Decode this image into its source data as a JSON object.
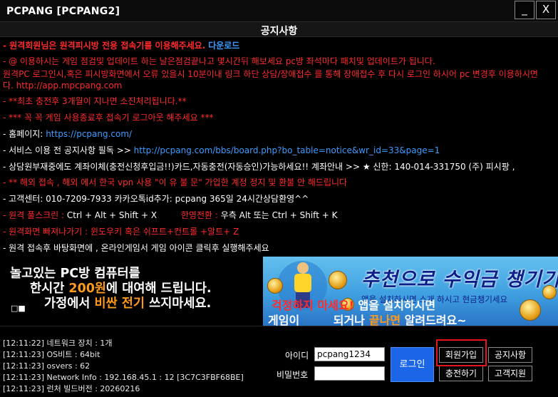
{
  "window": {
    "title": "PCPANG [PCPANG2]",
    "minimize_label": "_",
    "close_label": "X"
  },
  "notice": {
    "title": "공지사항",
    "lines": [
      {
        "a": "- 원격회원님은 원격피시방 전용 접속기를 이용해주세요.",
        "b": "다운로드"
      },
      {
        "a": "- @ 이용하시는 게임 점검및 업데이트 하는 날은점검끝나고 몇시간뒤 해보세요 pc방 좌석마다 패치및 업데이트가 됩니다."
      },
      {
        "a": "  원격PC 로그인시,혹은 피시방화면에서 오류 있을시 10분이내 링크 하단 상담/장애접수 를 통해 장애접수 후 다시 로그인 하시어 pc 변경후 이용하시면"
      },
      {
        "a": "  다. http://app.mpcpang.com"
      },
      {
        "a": "- **최초 충전후 3개월이 지나면 소진처리됩니다.**"
      },
      {
        "a": "- *** 꼭 꼭 게임 사용종료후 접속기 로그아웃 해주세요 ***"
      },
      {
        "a": "- 홈페이지:",
        "b": "https://pcpang.com/"
      },
      {
        "a": "- 서비스 이용 전 공지사항 필독 >>",
        "b": "http://pcpang.com/bbs/board.php?bo_table=notice&wr_id=33&page=1"
      },
      {
        "a": "- 상담원부재중에도 계좌이체(충전신청후입금!!)카드,자동충전(자동승인)가능하세요!! 계좌안내 >> ★ 신한: 140-014-331750 (주) 피시팡 ,"
      },
      {
        "a": "- ** 해외 접속 , 해외 에서 한국 vpn 사용 \"이 유 불 문\" 가입한 계정 정지 및 환불 안 해드립니다"
      },
      {
        "a": "- 고객센터: 010-7209-7933 카카오톡id추가: pcpang 365일 24시간상담환영^^"
      },
      {
        "a": "- 원격 풀스크린 :",
        "b": "Ctrl + Alt + Shift + X",
        "c": "한영전환 :",
        "d": "우측 Alt 또는 Ctrl + Shift + K"
      },
      {
        "a": "- 원격화면 빠져나가기 : 윈도우키 혹은 쉬프트+컨트롤 +알트+ Z"
      },
      {
        "a": "- 원격 접속후 바탕화면에 , 온라인게임서 게임 아이콘 클릭후 실행해주세요"
      }
    ]
  },
  "banner_left": {
    "line1": "놀고있는 PC방 컴퓨터를",
    "line2a": "한시간 ",
    "line2b": "200원",
    "line2c": "에 대여해 드립니다.",
    "line3a": "가정에서 ",
    "line3b": "비싼 전기",
    "line3c": " 쓰지마세요.",
    "dots": "□■"
  },
  "banner_right": {
    "headline": "추천으로 수익금 챙기기",
    "subtext": "앱을 설치하시면 소개 하시고 현금챙기세요",
    "overlay1a": "걱정하지 마세요!",
    "overlay1b": " 앱을 설치하시면",
    "overlay2a": "게임이 ",
    "overlay2b": "되거나",
    "overlay2c": "끝나면",
    "overlay2d": " 알려드려요~"
  },
  "log": [
    "[12:11:22] 네트워크 장치 : 1개",
    "[12:11:23] OS비트 : 64bit",
    "[12:11:23] osvers : 62",
    "[12:11:23] Network Info : 192.168.45.1 : 12 [3C7C3FBF68BE]",
    "[12:11:23] 런처 빌드버전 : 20260216"
  ],
  "login": {
    "id_label": "아이디",
    "id_value": "pcpang1234",
    "pw_label": "비밀번호",
    "pw_value": "",
    "login_button": "로그인",
    "register_button": "회원가입",
    "notice_button": "공지사항",
    "charge_button": "충전하기",
    "support_button": "고객지원"
  },
  "colors": {
    "red_text": "#ff2b2b",
    "link_blue": "#3d9bff",
    "login_blue": "#1a66e6",
    "highlight_red": "#e8141c",
    "accent_orange": "#ff9a1a"
  }
}
